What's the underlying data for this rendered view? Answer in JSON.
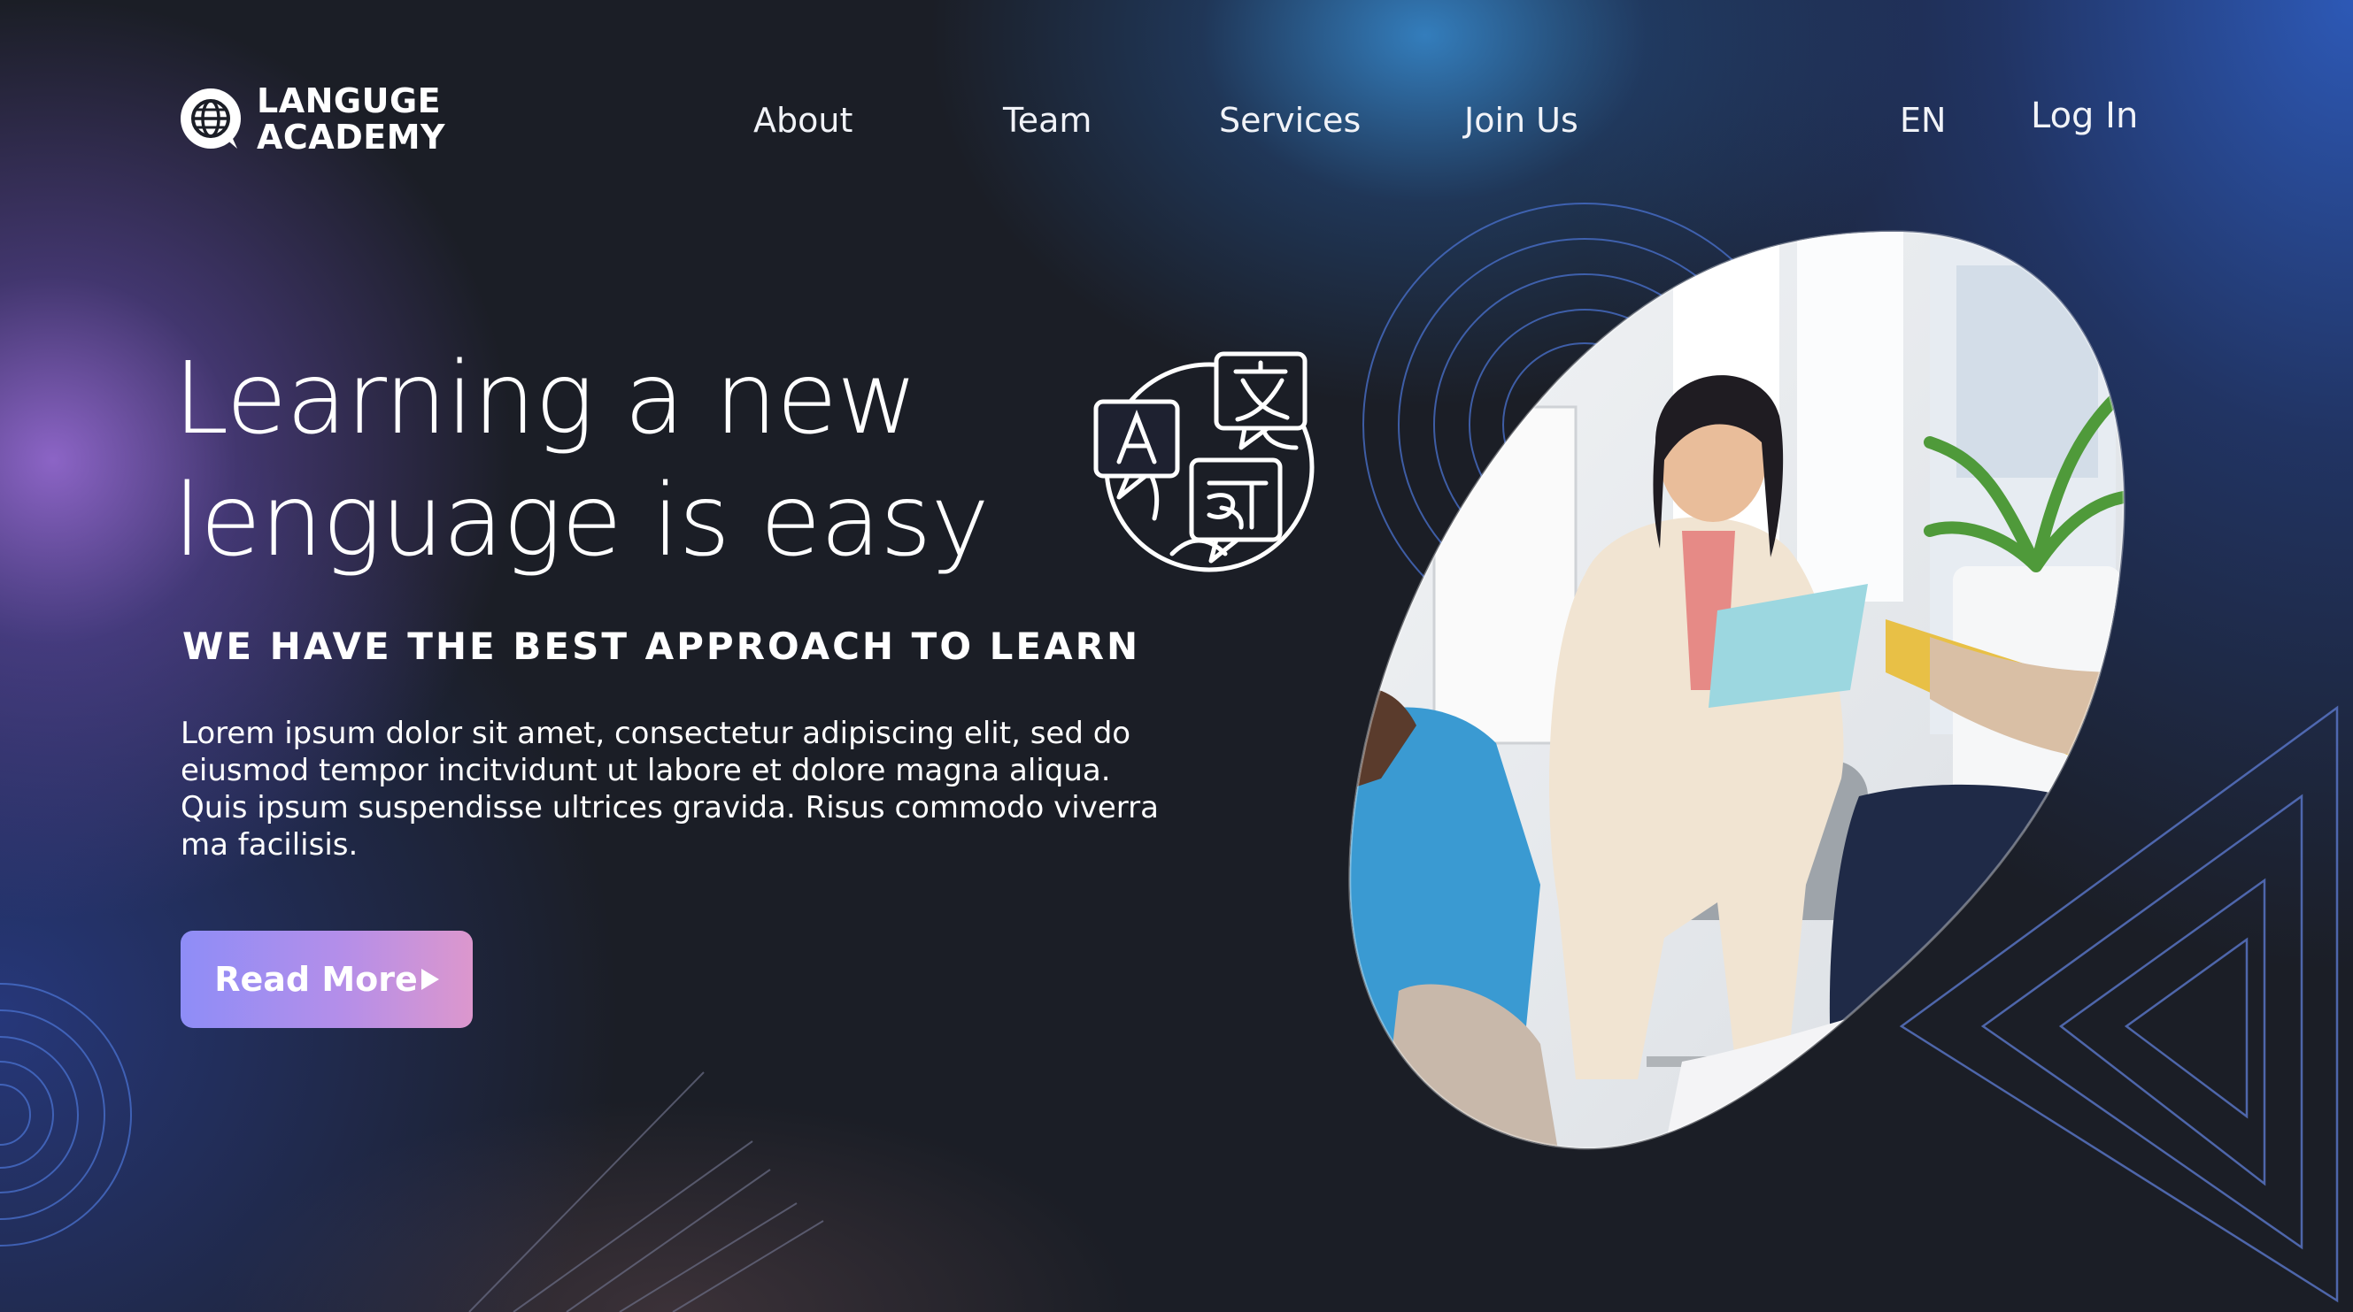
{
  "brand": {
    "line1": "LANGUGE",
    "line2": "ACADEMY",
    "icon": "globe-chat-icon"
  },
  "nav": {
    "links": [
      "About",
      "Team",
      "Services",
      "Join Us"
    ],
    "language": "EN",
    "login": "Log In"
  },
  "hero": {
    "headline_line1": "Learning a new",
    "headline_line2": "lenguage is easy",
    "subheading": "WE HAVE THE BEST APPROACH TO LEARN",
    "body": "Lorem ipsum dolor sit amet, consectetur adipiscing elit, sed do eiusmod tempor incitvidunt ut labore et dolore magna aliqua. Quis ipsum suspendisse ultrices gravida. Risus commodo viverra ma facilisis.",
    "cta": "Read More",
    "cta_icon": "play-arrow-icon",
    "feature_icon": "translate-globe-icon"
  },
  "photo": {
    "subject": "teacher-classroom-photo"
  },
  "colors": {
    "background": "#1b1e26",
    "accent_blue": "#3a8fd6",
    "accent_purple": "#9268ce",
    "button_start": "#8e8df7",
    "button_end": "#dc97cd"
  }
}
